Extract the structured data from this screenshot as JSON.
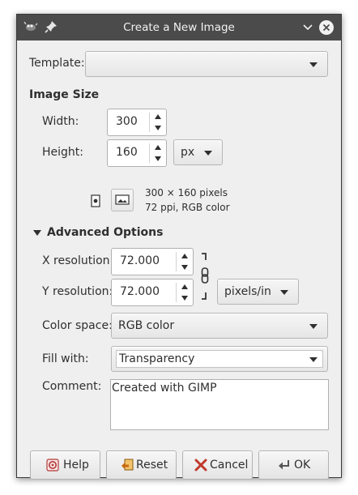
{
  "window": {
    "title": "Create a New Image"
  },
  "template": {
    "label": "Template:",
    "value": ""
  },
  "image_size": {
    "heading": "Image Size",
    "width_label": "Width:",
    "width_value": "300",
    "height_label": "Height:",
    "height_value": "160",
    "unit": "px",
    "info_line1": "300 × 160 pixels",
    "info_line2": "72 ppi, RGB color"
  },
  "advanced": {
    "heading": "Advanced Options",
    "x_res_label": "X resolution:",
    "x_res_value": "72.000",
    "y_res_label": "Y resolution:",
    "y_res_value": "72.000",
    "res_unit": "pixels/in",
    "color_space_label": "Color space:",
    "color_space_value": "RGB color",
    "fill_label": "Fill with:",
    "fill_value": "Transparency",
    "comment_label": "Comment:",
    "comment_value": "Created with GIMP"
  },
  "buttons": {
    "help": "Help",
    "reset": "Reset",
    "cancel": "Cancel",
    "ok": "OK"
  },
  "colors": {
    "titlebar": "#4b4b4b",
    "dialog_bg": "#efefef"
  }
}
